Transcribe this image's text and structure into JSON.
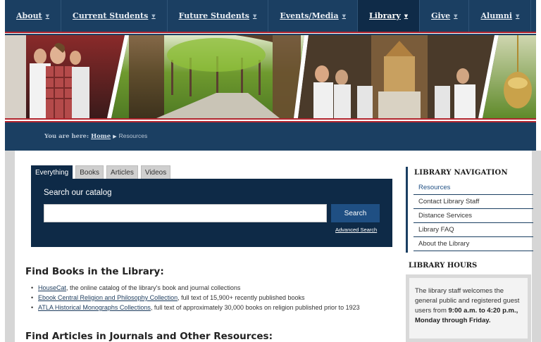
{
  "nav": {
    "items": [
      {
        "label": "About"
      },
      {
        "label": "Current Students"
      },
      {
        "label": "Future Students"
      },
      {
        "label": "Events/Media"
      },
      {
        "label": "Library"
      },
      {
        "label": "Give"
      },
      {
        "label": "Alumni"
      }
    ],
    "active": "Library"
  },
  "breadcrumb": {
    "prefix": "You are here:",
    "home": "Home",
    "current": "Resources"
  },
  "search": {
    "tabs": [
      "Everything",
      "Books",
      "Articles",
      "Videos"
    ],
    "active_tab": "Everything",
    "title": "Search our catalog",
    "input_value": "",
    "button_label": "Search",
    "advanced_label": "Advanced Search"
  },
  "main": {
    "books_heading": "Find Books in the Library:",
    "books_items": [
      {
        "link": "HouseCat",
        "text": ", the online catalog of the library's book and journal collections"
      },
      {
        "link": "Ebook Central Religion and Philosophy Collection",
        "text": ", full text of 15,900+ recently published books"
      },
      {
        "link": "ATLA Historical Monographs Collections",
        "text": ", full text of approximately 30,000 books on religion published prior to 1923"
      }
    ],
    "articles_heading": "Find Articles in Journals and Other Resources:"
  },
  "sidebar": {
    "nav_heading": "LIBRARY NAVIGATION",
    "nav_items": [
      {
        "label": "Resources"
      },
      {
        "label": "Contact Library Staff"
      },
      {
        "label": "Distance Services"
      },
      {
        "label": "Library FAQ"
      },
      {
        "label": "About the Library"
      }
    ],
    "hours_heading": "LIBRARY HOURS",
    "hours_text_1": "The library staff welcomes the general public and registered guest users from ",
    "hours_bold": "9:00 a.m. to 4:20 p.m., Monday through Friday.",
    "hours_text_2": ""
  },
  "colors": {
    "navy": "#1b3f62",
    "dark_navy": "#0e2a47",
    "accent_red": "#b2252e",
    "button_blue": "#1f4f83"
  }
}
